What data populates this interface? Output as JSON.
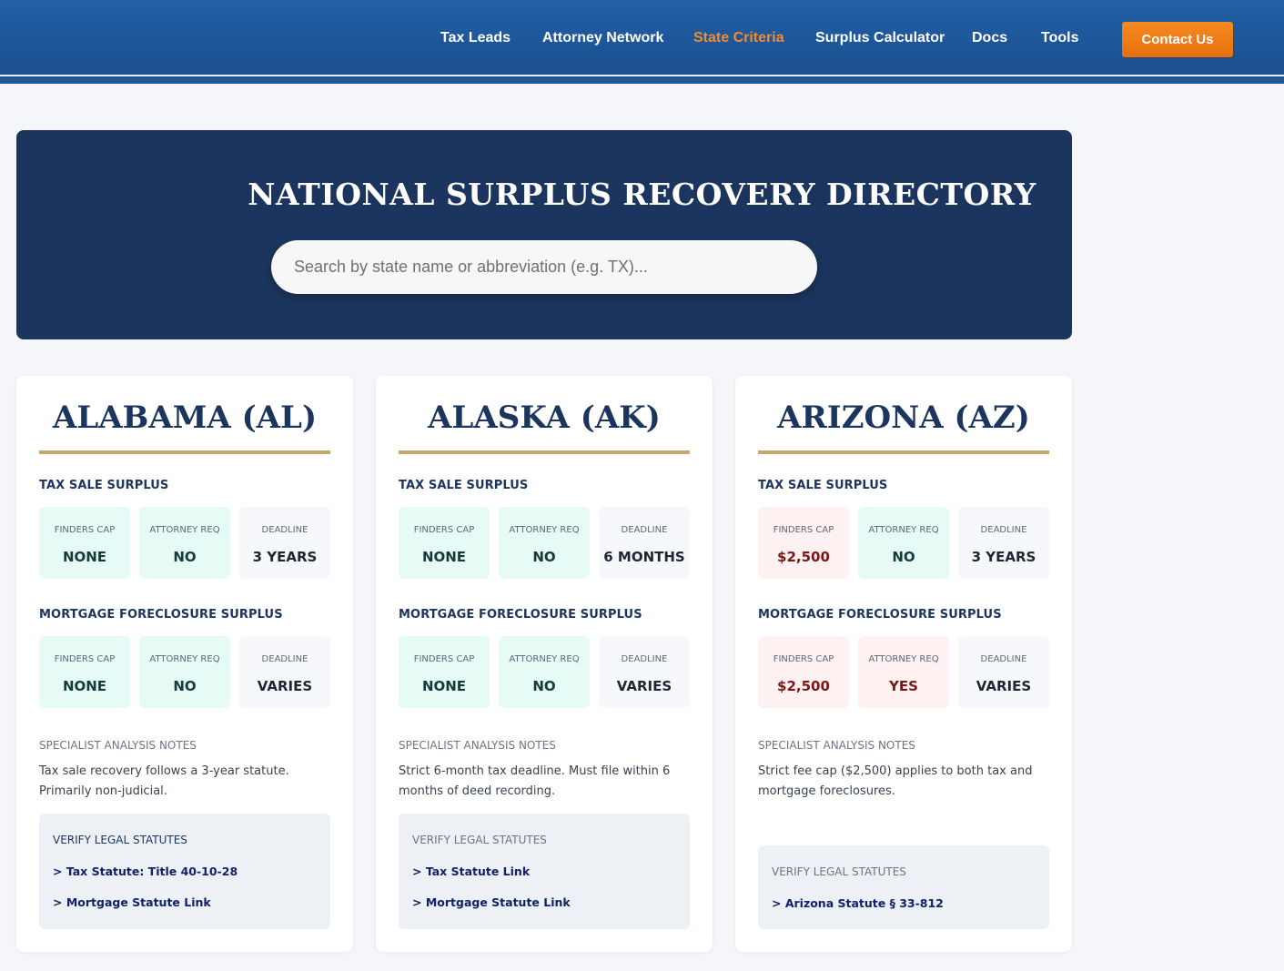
{
  "nav": {
    "links": [
      "Tax Leads",
      "Attorney Network",
      "State Criteria",
      "Surplus Calculator",
      "Docs",
      "Tools"
    ],
    "active": "State Criteria",
    "contact_label": "Contact Us"
  },
  "hero": {
    "title": "NATIONAL SURPLUS RECOVERY DIRECTORY",
    "search_placeholder": "Search by state name or abbreviation (e.g. TX)..."
  },
  "labels": {
    "tax_section": "TAX SALE SURPLUS",
    "mortgage_section": "MORTGAGE FORECLOSURE SURPLUS",
    "finders_cap": "FINDERS CAP",
    "attorney_req": "ATTORNEY REQ",
    "deadline": "DEADLINE",
    "notes": "SPECIALIST ANALYSIS NOTES",
    "verify": "VERIFY LEGAL STATUTES"
  },
  "states": [
    {
      "title": "ALABAMA (AL)",
      "tax": {
        "finders_cap": "NONE",
        "attorney_req": "NO",
        "deadline": "3 YEARS"
      },
      "mortgage": {
        "finders_cap": "NONE",
        "attorney_req": "NO",
        "deadline": "VARIES"
      },
      "notes": "Tax sale recovery follows a 3-year statute. Primarily non-judicial.",
      "links": [
        "> Tax Statute: Title 40-10-28",
        "> Mortgage Statute Link"
      ]
    },
    {
      "title": "ALASKA (AK)",
      "tax": {
        "finders_cap": "NONE",
        "attorney_req": "NO",
        "deadline": "6 MONTHS"
      },
      "mortgage": {
        "finders_cap": "NONE",
        "attorney_req": "NO",
        "deadline": "VARIES"
      },
      "notes": "Strict 6-month tax deadline. Must file within 6 months of deed recording.",
      "links": [
        "> Tax Statute Link",
        "> Mortgage Statute Link"
      ]
    },
    {
      "title": "ARIZONA (AZ)",
      "tax": {
        "finders_cap": "$2,500",
        "attorney_req": "NO",
        "deadline": "3 YEARS"
      },
      "mortgage": {
        "finders_cap": "$2,500",
        "attorney_req": "YES",
        "deadline": "VARIES"
      },
      "notes": "Strict fee cap ($2,500) applies to both tax and mortgage foreclosures.",
      "links": [
        "> Arizona Statute § 33-812"
      ]
    }
  ]
}
